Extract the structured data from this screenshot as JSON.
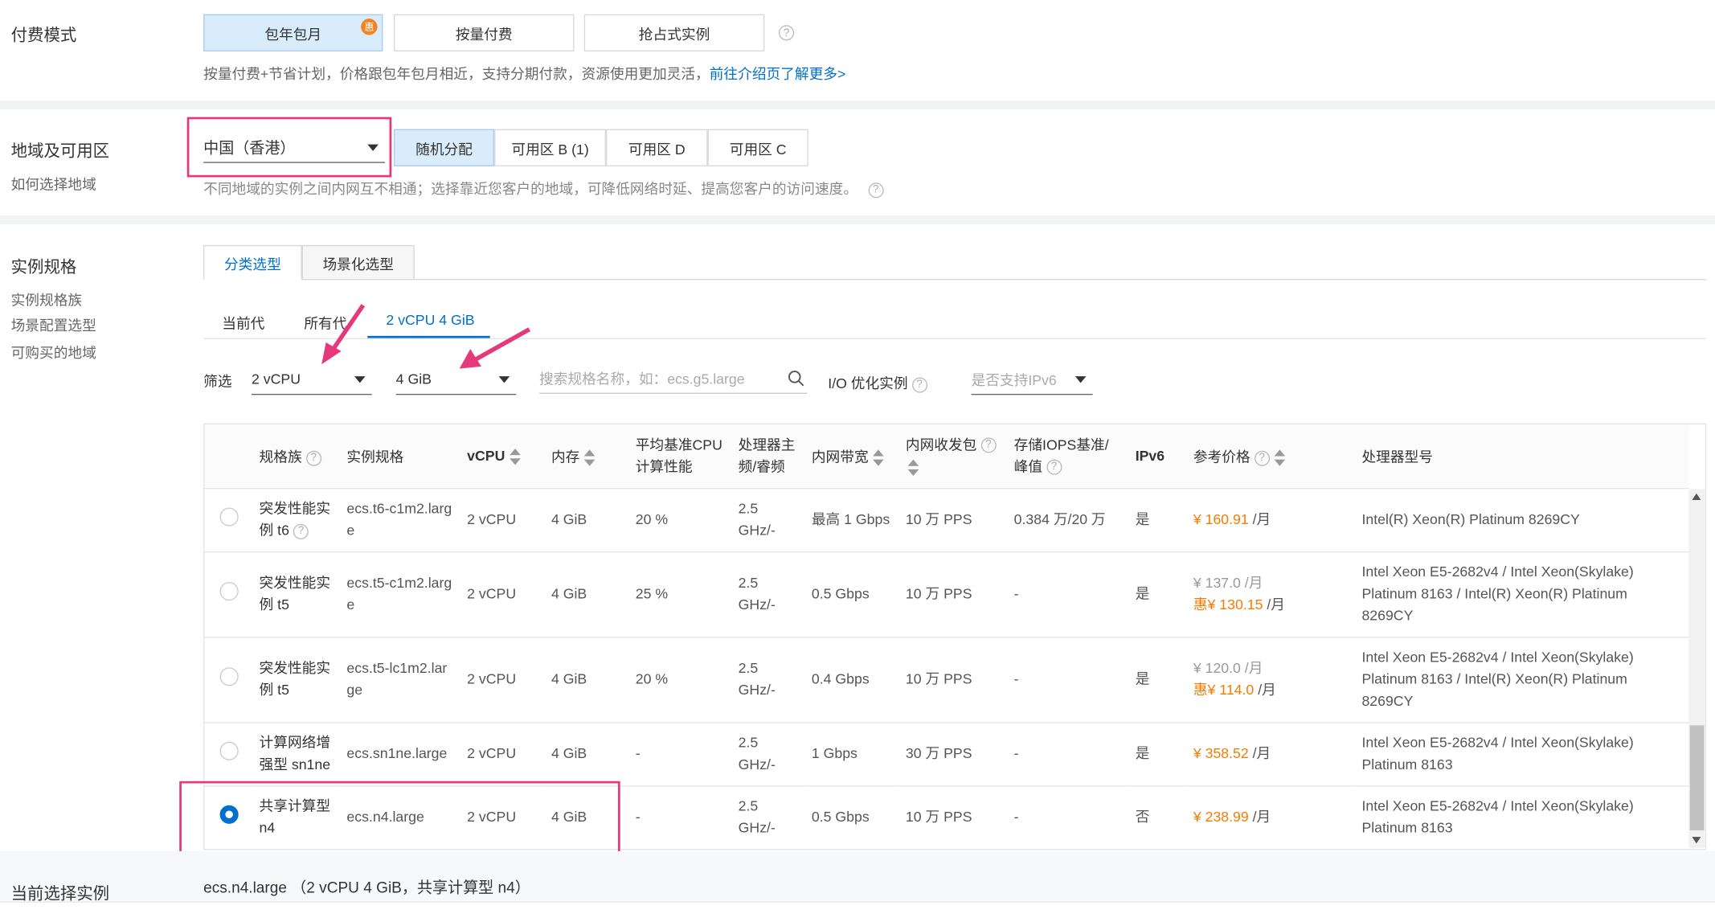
{
  "billing": {
    "label": "付费模式",
    "options": [
      "包年包月",
      "按量付费",
      "抢占式实例"
    ],
    "badge": "惠",
    "hint": "按量付费+节省计划，价格跟包年包月相近，支持分期付款，资源使用更加灵活，",
    "hint_link": "前往介绍页了解更多>"
  },
  "region": {
    "label": "地域及可用区",
    "sub_link": "如何选择地域",
    "selected": "中国（香港）",
    "zones": [
      "随机分配",
      "可用区 B (1)",
      "可用区 D",
      "可用区 C"
    ],
    "hint": "不同地域的实例之间内网互不相通；选择靠近您客户的地域，可降低网络时延、提高您客户的访问速度。"
  },
  "spec": {
    "label": "实例规格",
    "links": [
      "实例规格族",
      "场景配置选型",
      "可购买的地域"
    ],
    "tabs": [
      "分类选型",
      "场景化选型"
    ],
    "subtabs": [
      "当前代",
      "所有代",
      "2 vCPU 4 GiB"
    ],
    "filter_label": "筛选",
    "vcpu_filter": "2 vCPU",
    "mem_filter": "4 GiB",
    "search_placeholder": "搜索规格名称，如：ecs.g5.large",
    "io_label": "I/O 优化实例",
    "ipv6_placeholder": "是否支持IPv6"
  },
  "table": {
    "headers": [
      "规格族",
      "实例规格",
      "vCPU",
      "内存",
      "平均基准CPU计算性能",
      "处理器主频/睿频",
      "内网带宽",
      "内网收发包",
      "存储IOPS基准/峰值",
      "IPv6",
      "参考价格",
      "处理器型号"
    ],
    "rows": [
      {
        "family": "突发性能实例 t6",
        "spec": "ecs.t6-c1m2.large",
        "vcpu": "2 vCPU",
        "mem": "4 GiB",
        "cpu": "20 %",
        "freq": "2.5 GHz/-",
        "bw": "最高 1 Gbps",
        "pps": "10 万 PPS",
        "iops": "0.384 万/20 万",
        "ipv6": "是",
        "price": "¥ 160.91",
        "price_unit": " /月",
        "orig": "",
        "cpu_model": "Intel(R) Xeon(R) Platinum 8269CY",
        "selected": false
      },
      {
        "family": "突发性能实例 t5",
        "spec": "ecs.t5-c1m2.large",
        "vcpu": "2 vCPU",
        "mem": "4 GiB",
        "cpu": "25 %",
        "freq": "2.5 GHz/-",
        "bw": "0.5 Gbps",
        "pps": "10 万 PPS",
        "iops": "-",
        "ipv6": "是",
        "orig": "¥ 137.0 /月",
        "price": "惠¥ 130.15",
        "price_unit": " /月",
        "cpu_model": "Intel Xeon E5-2682v4 / Intel Xeon(Skylake) Platinum 8163 / Intel(R) Xeon(R) Platinum 8269CY",
        "selected": false
      },
      {
        "family": "突发性能实例 t5",
        "spec": "ecs.t5-lc1m2.large",
        "vcpu": "2 vCPU",
        "mem": "4 GiB",
        "cpu": "20 %",
        "freq": "2.5 GHz/-",
        "bw": "0.4 Gbps",
        "pps": "10 万 PPS",
        "iops": "-",
        "ipv6": "是",
        "orig": "¥ 120.0 /月",
        "price": "惠¥ 114.0",
        "price_unit": " /月",
        "cpu_model": "Intel Xeon E5-2682v4 / Intel Xeon(Skylake) Platinum 8163 / Intel(R) Xeon(R) Platinum 8269CY",
        "selected": false
      },
      {
        "family": "计算网络增强型 sn1ne",
        "spec": "ecs.sn1ne.large",
        "vcpu": "2 vCPU",
        "mem": "4 GiB",
        "cpu": "-",
        "freq": "2.5 GHz/-",
        "bw": "1 Gbps",
        "pps": "30 万 PPS",
        "iops": "-",
        "ipv6": "是",
        "orig": "",
        "price": "¥ 358.52",
        "price_unit": " /月",
        "cpu_model": "Intel Xeon E5-2682v4 / Intel Xeon(Skylake) Platinum 8163",
        "selected": false
      },
      {
        "family": "共享计算型 n4",
        "spec": "ecs.n4.large",
        "vcpu": "2 vCPU",
        "mem": "4 GiB",
        "cpu": "-",
        "freq": "2.5 GHz/-",
        "bw": "0.5 Gbps",
        "pps": "10 万 PPS",
        "iops": "-",
        "ipv6": "否",
        "orig": "",
        "price": "¥ 238.99",
        "price_unit": " /月",
        "cpu_model": "Intel Xeon E5-2682v4 / Intel Xeon(Skylake) Platinum 8163",
        "selected": true
      }
    ]
  },
  "current": {
    "label": "当前选择实例",
    "value": "ecs.n4.large （2 vCPU 4 GiB，共享计算型 n4）"
  },
  "colors": {
    "accent": "#0070cc",
    "price": "#f57c00",
    "highlight": "#e5397b"
  }
}
